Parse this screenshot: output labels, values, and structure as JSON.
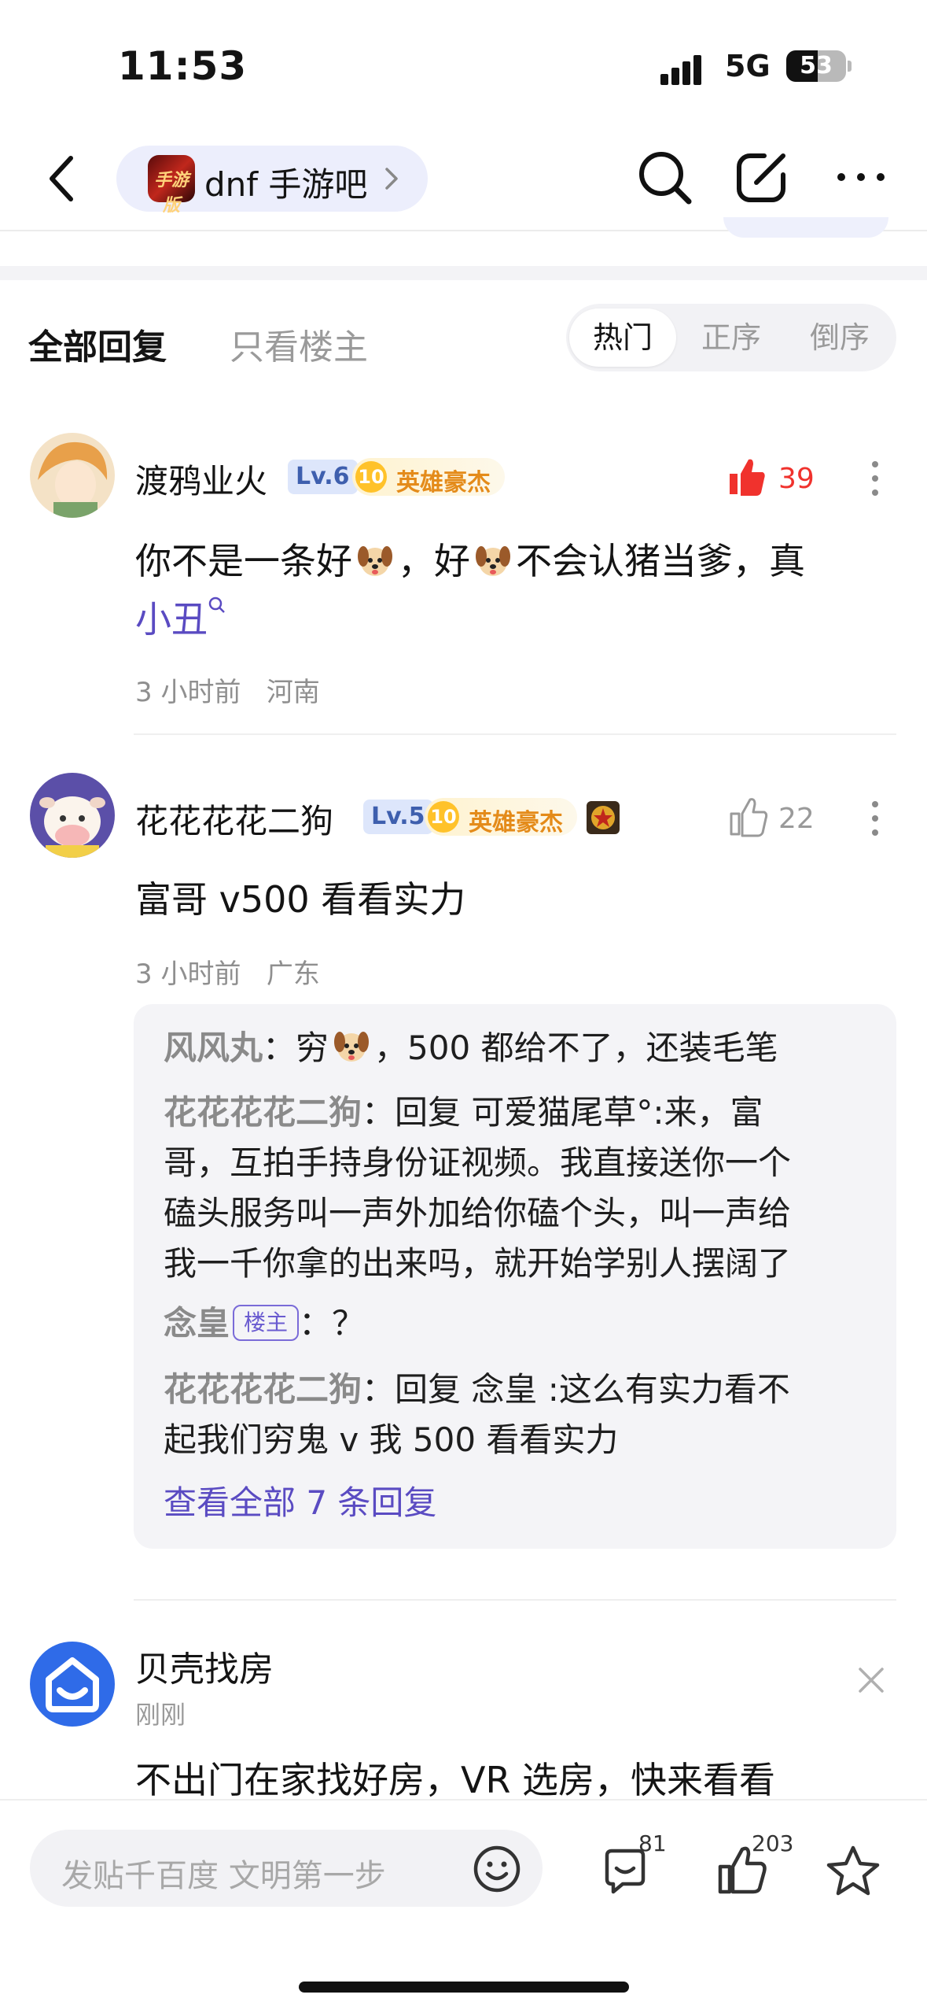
{
  "status_bar": {
    "time": "11:53",
    "network": "5G",
    "battery": "53",
    "battery_level": 0.53
  },
  "nav": {
    "forum_name": "dnf 手游吧",
    "forum_logo_text": "手游版"
  },
  "reply_header": {
    "tab_all": "全部回复",
    "tab_owner_only": "只看楼主",
    "sort_options": [
      "热门",
      "正序",
      "倒序"
    ],
    "active_sort": "热门"
  },
  "comments": [
    {
      "username": "渡鸦业火",
      "level": "Lv.6",
      "badge_num": "10",
      "badge_text": "英雄豪杰",
      "likes": "39",
      "liked": true,
      "text_part1": "你不是一条好",
      "text_part2": "，好",
      "text_part3": "不会认猪当爹，真",
      "text_link": "小丑",
      "time": "3 小时前",
      "location": "河南"
    },
    {
      "username": "花花花花二狗",
      "level": "Lv.5",
      "badge_num": "10",
      "badge_text": "英雄豪杰",
      "likes": "22",
      "liked": false,
      "text": "富哥 v500 看看实力",
      "time": "3 小时前",
      "location": "广东",
      "subreplies": [
        {
          "who": "风风丸",
          "sep": "：",
          "pre": "穷",
          "post": "，500 都给不了，还装毛笔"
        },
        {
          "who": "花花花花二狗",
          "sep": "：",
          "line1": "回复 可爱猫尾草°:来，富",
          "line2": "哥，互拍手持身份证视频。我直接送你一个",
          "line3": "磕头服务叫一声外加给你磕个头，叫一声给",
          "line4": "我一千你拿的出来吗，就开始学别人摆阔了"
        },
        {
          "who": "念皇",
          "owner_tag": "楼主",
          "sep": "：",
          "text": "？"
        },
        {
          "who": "花花花花二狗",
          "sep": "：",
          "line1": "回复 念皇 :这么有实力看不",
          "line2": "起我们穷鬼 v 我 500 看看实力"
        }
      ],
      "view_all": "查看全部 7 条回复"
    }
  ],
  "ad": {
    "name": "贝壳找房",
    "time": "刚刚",
    "text": "不出门在家找好房，VR 选房，快来看看"
  },
  "bottom_bar": {
    "placeholder": "发贴千百度 文明第一步",
    "comment_count": "81",
    "like_count": "203"
  },
  "colors": {
    "accent_purple": "#5a4bc2",
    "like_red": "#f0322d",
    "badge_gold": "#e48b1a",
    "level_blue": "#3e5fae"
  }
}
